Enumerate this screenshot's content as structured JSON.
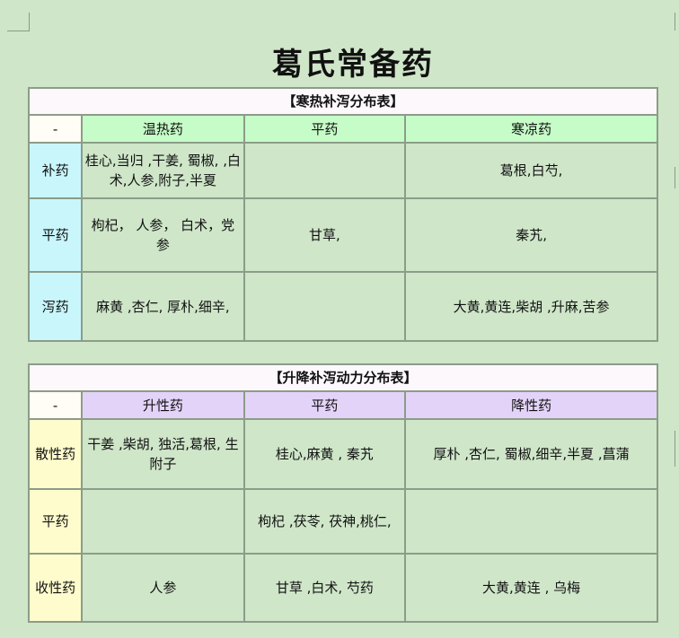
{
  "title": "葛氏常备药",
  "tables": [
    {
      "caption": "【寒热补泻分布表】",
      "corner": "-",
      "columns": [
        "温热药",
        "平药",
        "寒凉药"
      ],
      "rows": [
        {
          "label": "补药",
          "cells": [
            "桂心,当归 ,干姜, 蜀椒, ,白术,人参,附子,半夏",
            "",
            "葛根,白芍,"
          ]
        },
        {
          "label": "平药",
          "cells": [
            "枸杞， 人参， 白术，党参",
            "甘草,",
            "秦艽,"
          ]
        },
        {
          "label": "泻药",
          "cells": [
            "麻黄 ,杏仁, 厚朴,细辛,",
            "",
            "大黄,黄连,柴胡 ,升麻,苦参"
          ]
        }
      ]
    },
    {
      "caption": "【升降补泻动力分布表】",
      "corner": "-",
      "columns": [
        "升性药",
        "平药",
        "降性药"
      ],
      "rows": [
        {
          "label": "散性药",
          "cells": [
            "干姜 ,柴胡, 独活,葛根, 生附子",
            "桂心,麻黄 , 秦艽",
            "厚朴 ,杏仁, 蜀椒,细辛,半夏 ,菖蒲"
          ]
        },
        {
          "label": "平药",
          "cells": [
            "",
            "枸杞 ,茯苓, 茯神,桃仁,",
            ""
          ]
        },
        {
          "label": "收性药",
          "cells": [
            "人参",
            "甘草 ,白术, 芍药",
            "大黄,黄连 , 乌梅"
          ]
        }
      ]
    }
  ]
}
